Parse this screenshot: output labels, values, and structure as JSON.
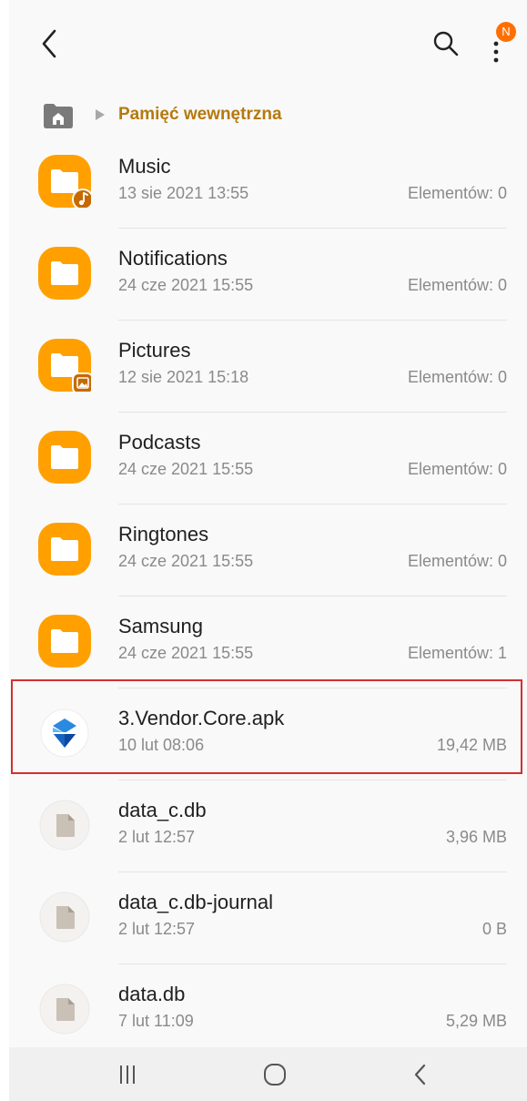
{
  "appbar": {
    "back": "back-arrow-icon",
    "search": "search-icon",
    "more": "more-vertical-icon",
    "badge_letter": "N"
  },
  "breadcrumb": {
    "home": "home-folder-icon",
    "label": "Pamięć wewnętrzna"
  },
  "files": [
    {
      "name": "Music",
      "date": "13 sie 2021 13:55",
      "meta": "Elementów: 0",
      "icon": "folder-music-icon"
    },
    {
      "name": "Notifications",
      "date": "24 cze 2021 15:55",
      "meta": "Elementów: 0",
      "icon": "folder-icon"
    },
    {
      "name": "Pictures",
      "date": "12 sie 2021 15:18",
      "meta": "Elementów: 0",
      "icon": "folder-pictures-icon"
    },
    {
      "name": "Podcasts",
      "date": "24 cze 2021 15:55",
      "meta": "Elementów: 0",
      "icon": "folder-icon"
    },
    {
      "name": "Ringtones",
      "date": "24 cze 2021 15:55",
      "meta": "Elementów: 0",
      "icon": "folder-icon"
    },
    {
      "name": "Samsung",
      "date": "24 cze 2021 15:55",
      "meta": "Elementów: 1",
      "icon": "folder-icon"
    },
    {
      "name": "3.Vendor.Core.apk",
      "date": "10 lut 08:06",
      "meta": "19,42 MB",
      "icon": "apk-app-icon"
    },
    {
      "name": "data_c.db",
      "date": "2 lut 12:57",
      "meta": "3,96 MB",
      "icon": "file-icon"
    },
    {
      "name": "data_c.db-journal",
      "date": "2 lut 12:57",
      "meta": "0 B",
      "icon": "file-icon"
    },
    {
      "name": "data.db",
      "date": "7 lut 11:09",
      "meta": "5,29 MB",
      "icon": "file-icon"
    }
  ],
  "navbar": {
    "recents": "recents-icon",
    "home": "home-button-icon",
    "back": "back-nav-icon"
  },
  "colors": {
    "folder": "#ffa000",
    "folder_badge": "#c66a00",
    "breadcrumb_text": "#b5790d",
    "highlight": "#d32f2f",
    "notification_badge": "#ff6f00"
  }
}
